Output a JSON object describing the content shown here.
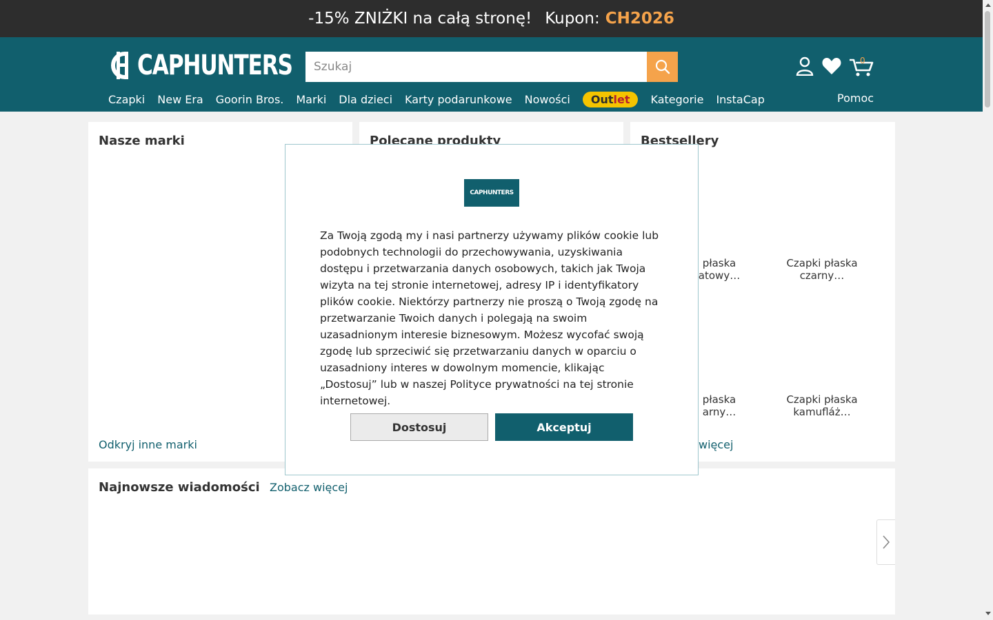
{
  "promo": {
    "text": "-15% ZNIŻKI na całą stronę!",
    "coupon_label": "Kupon:",
    "coupon_code": "CH2026"
  },
  "header": {
    "logo_text": "CAPHUNTERS",
    "search_placeholder": "Szukaj",
    "cart_count": "0",
    "nav": [
      "Czapki",
      "New Era",
      "Goorin Bros.",
      "Marki",
      "Dla dzieci",
      "Karty podarunkowe",
      "Nowości"
    ],
    "outlet_a": "Out",
    "outlet_b": "let",
    "nav_after": [
      "Kategorie",
      "InstaCap"
    ],
    "help": "Pomoc"
  },
  "sections": {
    "brands": {
      "title": "Nasze marki",
      "link": "Odkryj inne marki"
    },
    "featured": {
      "title": "Polecane produkty"
    },
    "bestsellers": {
      "title": "Bestsellery",
      "products": [
        {
          "line1": "płaska",
          "line2": "atowy…"
        },
        {
          "line1": "Czapki płaska",
          "line2": "czarny…"
        },
        {
          "line1": "płaska",
          "line2": "arny…"
        },
        {
          "line1": "Czapki płaska",
          "line2": "kamufláż…"
        }
      ],
      "link": "więcej"
    },
    "news": {
      "title": "Najnowsze wiadomości",
      "link": "Zobacz więcej"
    }
  },
  "cookie_modal": {
    "logo_text": "CAPHUNTERS",
    "text": "Za Twoją zgodą my i nasi partnerzy używamy plików cookie lub podobnych technologii do przechowywania, uzyskiwania dostępu i przetwarzania danych osobowych, takich jak Twoja wizyta na tej stronie internetowej, adresy IP i identyfikatory plików cookie. Niektórzy partnerzy nie proszą o Twoją zgodę na przetwarzanie Twoich danych i polegają na swoim uzasadnionym interesie biznesowym. Możesz wycofać swoją zgodę lub sprzeciwić się przetwarzaniu danych w oparciu o uzasadniony interes w dowolnym momencie, klikając „Dostosuj” lub w naszej Polityce prywatności na tej stronie internetowej.",
    "customize_label": "Dostosuj",
    "accept_label": "Akceptuj"
  },
  "colors": {
    "brand": "#115f6d",
    "accent": "#f5a34b",
    "promo_bg": "#2d2d2d"
  }
}
